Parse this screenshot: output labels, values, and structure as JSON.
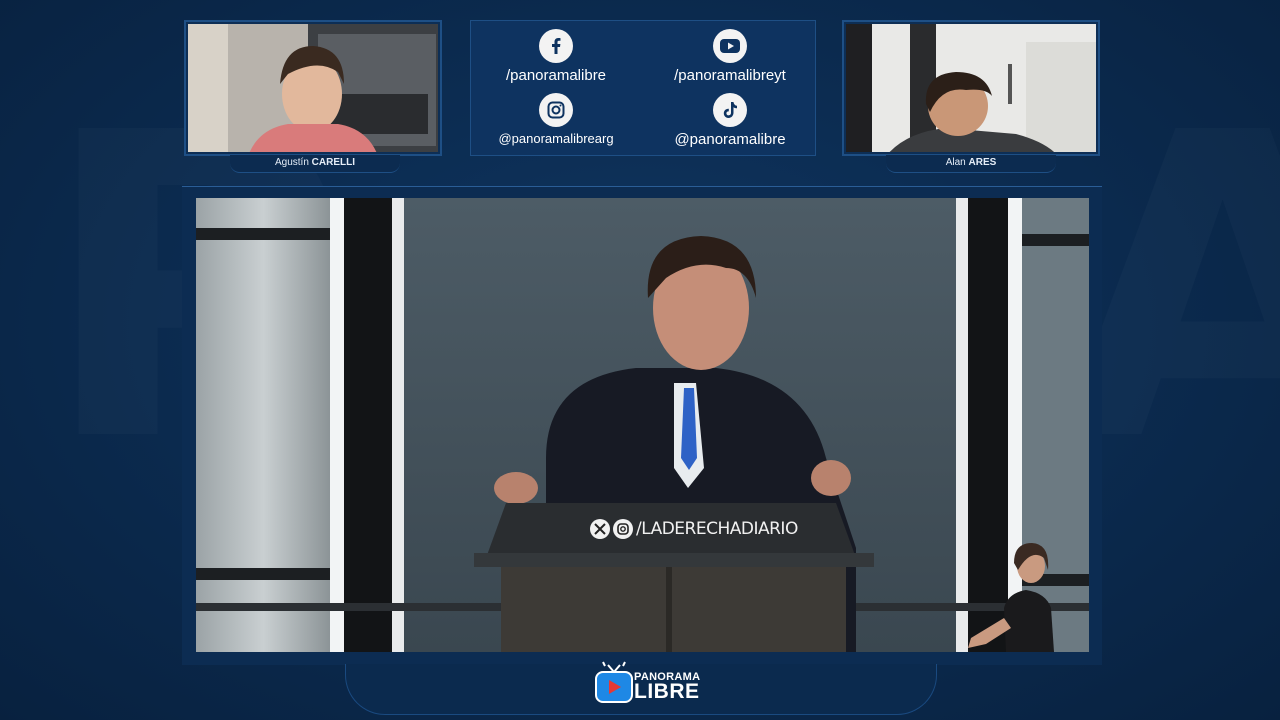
{
  "left_camera": {
    "first_name": "Agustín",
    "last_name": "CARELLI"
  },
  "right_camera": {
    "first_name": "Alan",
    "last_name": "ARES"
  },
  "socials": [
    {
      "icon": "facebook-icon",
      "handle": "/panoramalibre"
    },
    {
      "icon": "youtube-icon",
      "handle": "/panoramalibreyt"
    },
    {
      "icon": "instagram-icon",
      "handle": "@panoramalibrearg"
    },
    {
      "icon": "tiktok-icon",
      "handle": "@panoramalibre"
    }
  ],
  "video": {
    "podium_handle": "/LADERECHADIARIO"
  },
  "logo": {
    "top": "PANORAMA",
    "bottom": "LIBRE"
  },
  "colors": {
    "background": "#0b2a4e",
    "panel": "#0e3360",
    "border": "#1e4f85",
    "logo_red": "#e53935",
    "logo_blue": "#1e88e5"
  }
}
